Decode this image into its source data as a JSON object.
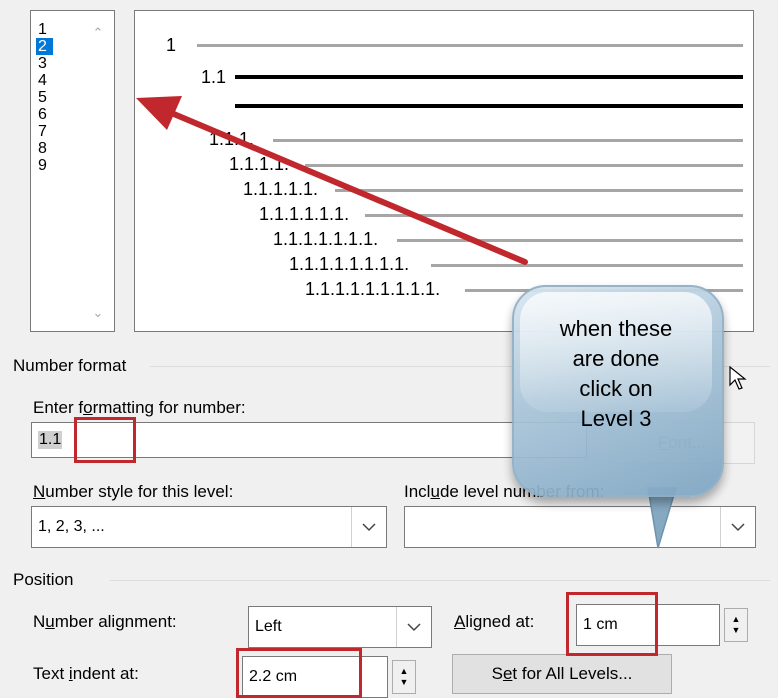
{
  "levels": {
    "items": [
      "1",
      "2",
      "3",
      "4",
      "5",
      "6",
      "7",
      "8",
      "9"
    ],
    "selected_index": 1
  },
  "preview": {
    "rows": [
      "1",
      "1.1",
      "",
      "1.1.1.",
      "1.1.1.1.",
      "1.1.1.1.1.",
      "1.1.1.1.1.1.",
      "1.1.1.1.1.1.1.",
      "1.1.1.1.1.1.1.1.",
      "1.1.1.1.1.1.1.1.1."
    ]
  },
  "number_format": {
    "group_label": "Number format",
    "enter_formatting_label": "Enter formatting for number:",
    "format_value": "1.1",
    "font_button": "Font...",
    "number_style_label": "Number style for this level:",
    "number_style_value": "1, 2, 3, ...",
    "include_level_label": "Include level number from:",
    "include_level_value": ""
  },
  "position": {
    "group_label": "Position",
    "number_alignment_label": "Number alignment:",
    "number_alignment_value": "Left",
    "aligned_at_label": "Aligned at:",
    "aligned_at_value": "1 cm",
    "text_indent_label": "Text indent at:",
    "text_indent_value": "2.2 cm",
    "set_all_levels_button": "Set for All Levels..."
  },
  "annotation": {
    "callout_text": [
      "when these",
      "are done",
      "click on",
      "Level 3"
    ],
    "accent_color": "#c0282d"
  }
}
